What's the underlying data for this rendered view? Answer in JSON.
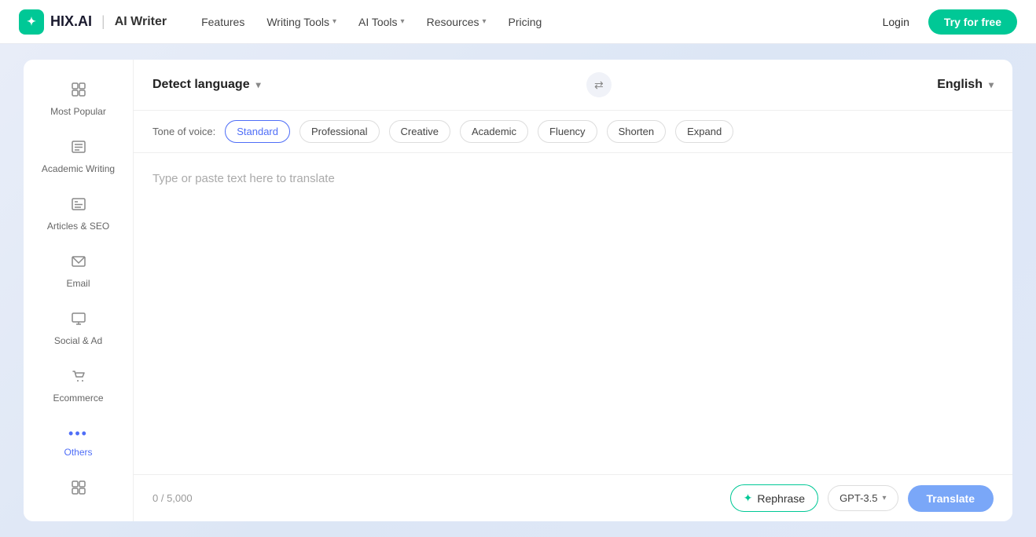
{
  "navbar": {
    "logo_text": "HIX.AI",
    "logo_icon": "✦",
    "logo_divider": "|",
    "logo_sub": "AI Writer",
    "nav_links": [
      {
        "label": "Features",
        "has_chevron": false
      },
      {
        "label": "Writing Tools",
        "has_chevron": true
      },
      {
        "label": "AI Tools",
        "has_chevron": true
      },
      {
        "label": "Resources",
        "has_chevron": true
      },
      {
        "label": "Pricing",
        "has_chevron": false
      }
    ],
    "login_label": "Login",
    "try_label": "Try for free"
  },
  "sidebar": {
    "items": [
      {
        "id": "most-popular",
        "icon": "⊞",
        "label": "Most Popular"
      },
      {
        "id": "academic-writing",
        "icon": "▤",
        "label": "Academic Writing"
      },
      {
        "id": "articles-seo",
        "icon": "▬",
        "label": "Articles & SEO"
      },
      {
        "id": "email",
        "icon": "✉",
        "label": "Email"
      },
      {
        "id": "social-ad",
        "icon": "⊡",
        "label": "Social & Ad"
      },
      {
        "id": "ecommerce",
        "icon": "🛒",
        "label": "Ecommerce"
      },
      {
        "id": "others",
        "icon": "•••",
        "label": "Others",
        "active": true
      },
      {
        "id": "all",
        "icon": "⊞",
        "label": ""
      }
    ]
  },
  "main": {
    "detect_language_label": "Detect language",
    "swap_icon": "⇄",
    "target_language": "English",
    "tone_label": "Tone of voice:",
    "tones": [
      {
        "id": "standard",
        "label": "Standard",
        "active": true
      },
      {
        "id": "professional",
        "label": "Professional",
        "active": false
      },
      {
        "id": "creative",
        "label": "Creative",
        "active": false
      },
      {
        "id": "academic",
        "label": "Academic",
        "active": false
      },
      {
        "id": "fluency",
        "label": "Fluency",
        "active": false
      },
      {
        "id": "shorten",
        "label": "Shorten",
        "active": false
      },
      {
        "id": "expand",
        "label": "Expand",
        "active": false
      }
    ],
    "textarea_placeholder": "Type or paste text here to translate",
    "word_count": "0 / 5,000",
    "rephrase_label": "Rephrase",
    "rephrase_icon": "✦",
    "gpt_model": "GPT-3.5",
    "translate_label": "Translate"
  }
}
